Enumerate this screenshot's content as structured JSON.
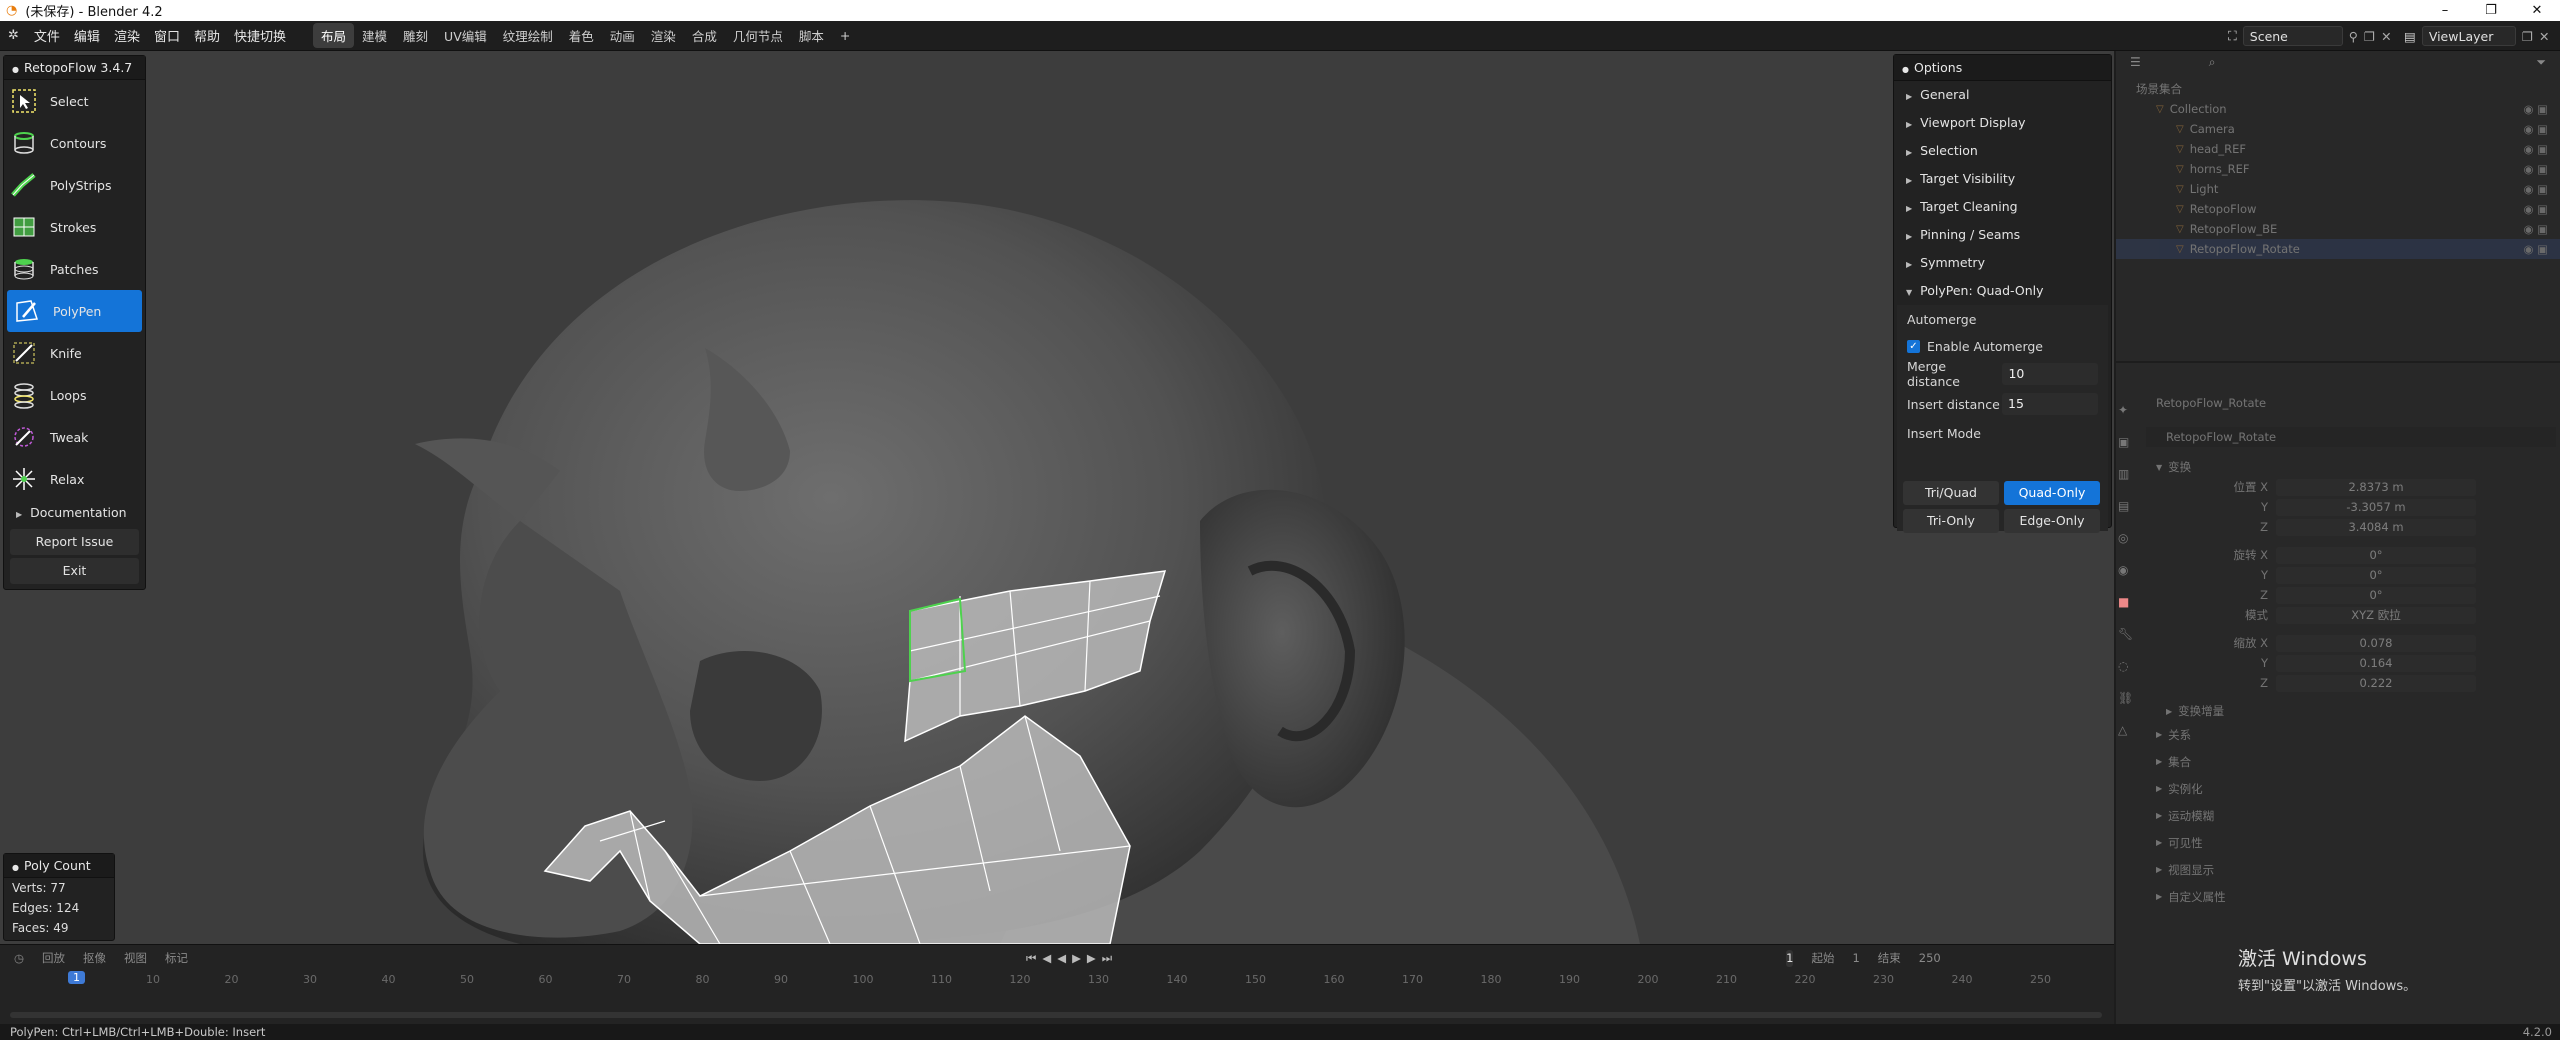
{
  "title": "(未保存) - Blender 4.2",
  "window_buttons": [
    "–",
    "❐",
    "✕"
  ],
  "menu": [
    "文件",
    "编辑",
    "渲染",
    "窗口",
    "帮助",
    "快捷切换"
  ],
  "workspaces": [
    "布局",
    "建模",
    "雕刻",
    "UV编辑",
    "纹理绘制",
    "着色",
    "动画",
    "渲染",
    "合成",
    "几何节点",
    "脚本",
    "+"
  ],
  "scene": "Scene",
  "view_layer": "ViewLayer",
  "tool_panel": {
    "title": "RetopoFlow 3.4.7",
    "tools": [
      {
        "label": "Select",
        "icon": "select-icon"
      },
      {
        "label": "Contours",
        "icon": "contours-icon"
      },
      {
        "label": "PolyStrips",
        "icon": "polystrips-icon"
      },
      {
        "label": "Strokes",
        "icon": "strokes-icon"
      },
      {
        "label": "Patches",
        "icon": "patches-icon"
      },
      {
        "label": "PolyPen",
        "icon": "polypen-icon"
      },
      {
        "label": "Knife",
        "icon": "knife-icon"
      },
      {
        "label": "Loops",
        "icon": "loops-icon"
      },
      {
        "label": "Tweak",
        "icon": "tweak-icon"
      },
      {
        "label": "Relax",
        "icon": "relax-icon"
      }
    ],
    "active_tool": "PolyPen",
    "documentation": "Documentation",
    "report": "Report Issue",
    "exit": "Exit"
  },
  "options": {
    "title": "Options",
    "sections": [
      "General",
      "Viewport Display",
      "Selection",
      "Target Visibility",
      "Target Cleaning",
      "Pinning / Seams",
      "Symmetry"
    ],
    "expanded": "PolyPen: Quad-Only",
    "automerge_label": "Automerge",
    "enable_automerge": "Enable Automerge",
    "merge_distance_label": "Merge distance",
    "merge_distance": "10",
    "insert_distance_label": "Insert distance",
    "insert_distance": "15",
    "insert_mode_label": "Insert Mode",
    "modes": [
      "Tri/Quad",
      "Quad-Only",
      "Tri-Only",
      "Edge-Only"
    ],
    "selected_mode": "Quad-Only"
  },
  "poly_count": {
    "title": "Poly Count",
    "verts": "Verts:  77",
    "edges": "Edges: 124",
    "faces": "Faces:  49"
  },
  "timeline": {
    "current_frame": "1",
    "ticks": [
      "10",
      "20",
      "30",
      "40",
      "50",
      "60",
      "70",
      "80",
      "90",
      "100",
      "110",
      "120",
      "130",
      "140",
      "150",
      "160",
      "170",
      "180",
      "190",
      "200",
      "210",
      "220",
      "230",
      "240",
      "250"
    ],
    "controls": [
      "回放",
      "抠像",
      "视图",
      "标记"
    ],
    "frame_field": "1",
    "start_label": "起始",
    "start": "1",
    "end_label": "结束",
    "end": "250"
  },
  "outliner": {
    "header": "场景集合",
    "items": [
      {
        "label": "Collection",
        "depth": 1
      },
      {
        "label": "Camera",
        "depth": 2
      },
      {
        "label": "head_REF",
        "depth": 2
      },
      {
        "label": "horns_REF",
        "depth": 2
      },
      {
        "label": "Light",
        "depth": 2
      },
      {
        "label": "RetopoFlow",
        "depth": 2
      },
      {
        "label": "RetopoFlow_BE",
        "depth": 2
      },
      {
        "label": "RetopoFlow_Rotate",
        "depth": 2
      }
    ]
  },
  "properties": {
    "object_name": "RetopoFlow_Rotate",
    "object_name2": "RetopoFlow_Rotate",
    "transform": "变换",
    "location_label": "位置 X",
    "loc": [
      "2.8373 m",
      "-3.3057 m",
      "3.4084 m"
    ],
    "rotation_label": "旋转 X",
    "rot": [
      "0°",
      "0°",
      "0°"
    ],
    "mode_label": "模式",
    "mode_value": "XYZ 欧拉",
    "scale_label": "缩放 X",
    "scale": [
      "0.078",
      "0.164",
      "0.222"
    ],
    "yz": [
      "Y",
      "Z"
    ],
    "delta": "变换增量",
    "groups": [
      "关系",
      "集合",
      "实例化",
      "运动模糊",
      "可见性",
      "视图显示",
      "自定义属性"
    ]
  },
  "activate": {
    "title": "激活 Windows",
    "sub": "转到\"设置\"以激活 Windows。"
  },
  "status": "PolyPen: Ctrl+LMB/Ctrl+LMB+Double: Insert",
  "version": "4.2.0",
  "colors": {
    "accent": "#1474d8",
    "green": "#4ed24e",
    "viewport": "#3d3d3d"
  }
}
